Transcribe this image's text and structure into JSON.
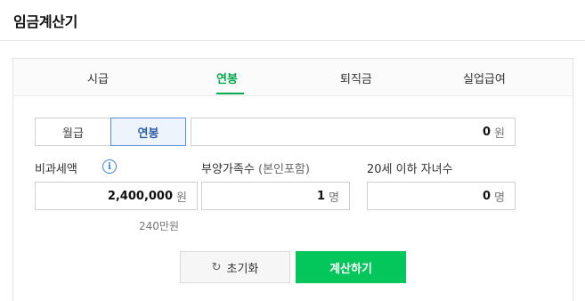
{
  "header": {
    "title": "임금계산기"
  },
  "tabs": [
    {
      "label": "시급"
    },
    {
      "label": "연봉"
    },
    {
      "label": "퇴직금"
    },
    {
      "label": "실업급여"
    }
  ],
  "active_tab": "연봉",
  "pay_type": {
    "options": [
      {
        "label": "월급"
      },
      {
        "label": "연봉"
      }
    ],
    "selected": "연봉"
  },
  "salary": {
    "value": "0",
    "unit": "원"
  },
  "nontaxable": {
    "label": "비과세액",
    "info_icon": "info-icon",
    "value": "2,400,000",
    "unit": "원",
    "helper": "240만원"
  },
  "dependents": {
    "label": "부양가족수",
    "sublabel": "(본인포함)",
    "value": "1",
    "unit": "명"
  },
  "children": {
    "label": "20세 이하 자녀수",
    "value": "0",
    "unit": "명"
  },
  "buttons": {
    "reset_label": "초기화",
    "reset_icon": "refresh-icon",
    "calc_label": "계산하기"
  },
  "colors": {
    "accent": "#03c75a",
    "tab_active": "#03a94d",
    "info": "#3b82d6",
    "segment_active": "#2b5fa8"
  }
}
